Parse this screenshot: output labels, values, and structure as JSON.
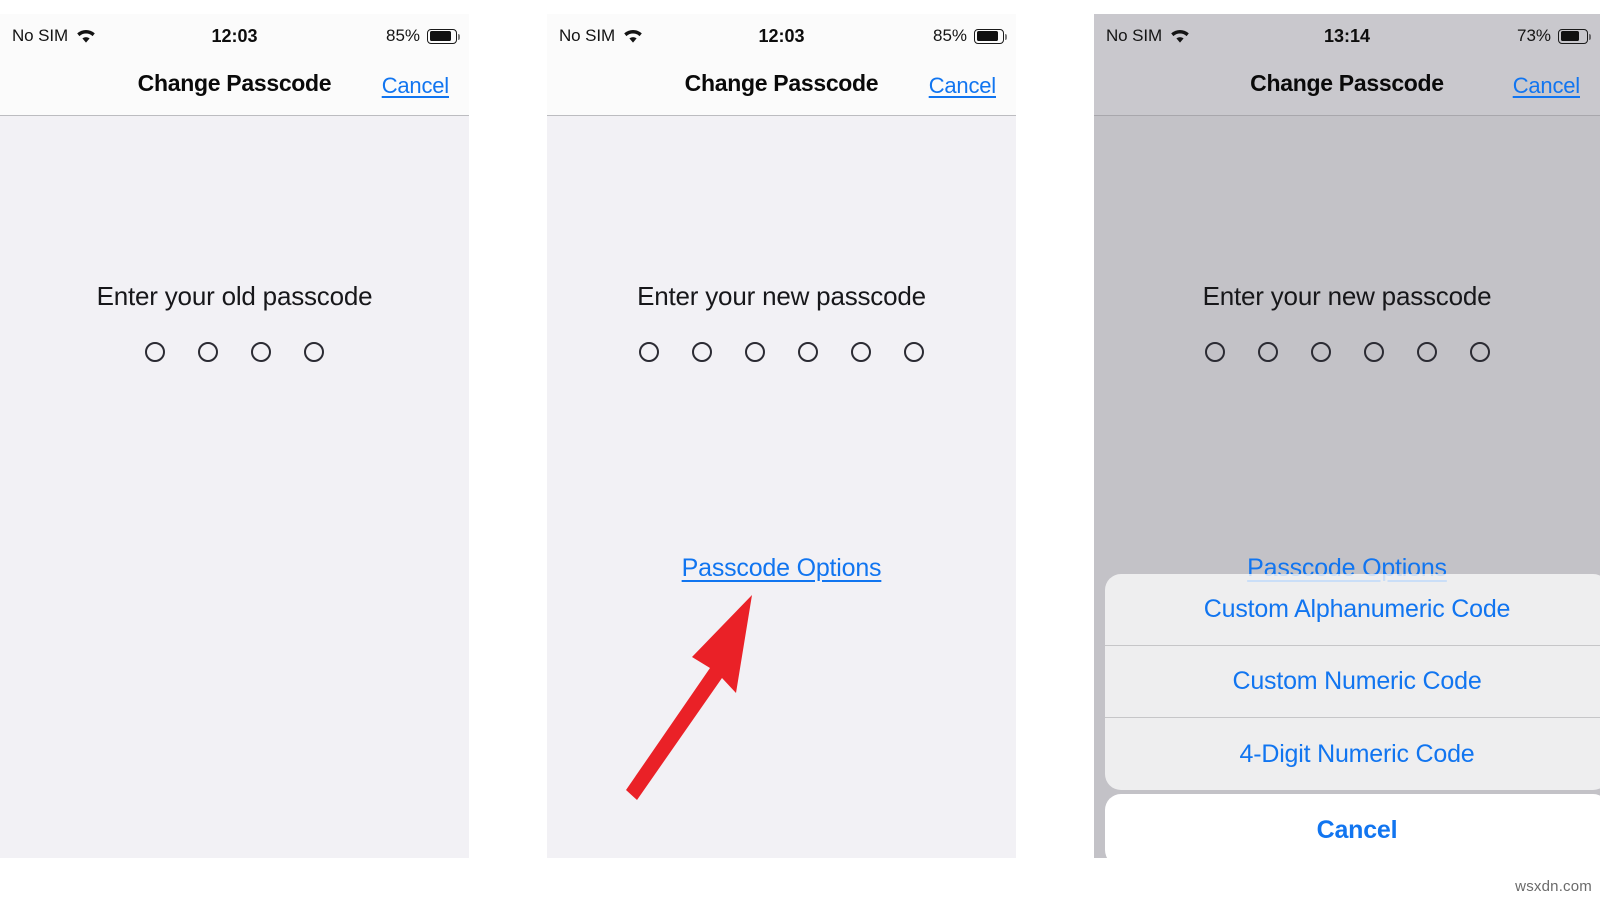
{
  "watermark": "wsxdn.com",
  "colors": {
    "accent_blue": "#1175f0",
    "arrow_red": "#ea2127",
    "screen_bg": "#f2f1f5",
    "dimmed_bg": "#c3c2c7",
    "bar_bg": "#fbfbfb",
    "text": "#141414"
  },
  "panels": [
    {
      "id": "panel-old-passcode",
      "status_bar": {
        "carrier": "No SIM",
        "wifi_icon": "wifi-icon",
        "time": "12:03",
        "battery_percent": "85%",
        "battery_icon": "battery-icon",
        "battery_level": 85
      },
      "nav": {
        "title": "Change Passcode",
        "cancel_label": "Cancel"
      },
      "prompt": "Enter your old passcode",
      "dot_count": 4,
      "passcode_options_label": null,
      "dimmed": false
    },
    {
      "id": "panel-new-passcode",
      "status_bar": {
        "carrier": "No SIM",
        "wifi_icon": "wifi-icon",
        "time": "12:03",
        "battery_percent": "85%",
        "battery_icon": "battery-icon",
        "battery_level": 85
      },
      "nav": {
        "title": "Change Passcode",
        "cancel_label": "Cancel"
      },
      "prompt": "Enter your new passcode",
      "dot_count": 6,
      "passcode_options_label": "Passcode Options",
      "dimmed": false
    },
    {
      "id": "panel-passcode-options-sheet",
      "status_bar": {
        "carrier": "No SIM",
        "wifi_icon": "wifi-icon",
        "time": "13:14",
        "battery_percent": "73%",
        "battery_icon": "battery-icon",
        "battery_level": 73
      },
      "nav": {
        "title": "Change Passcode",
        "cancel_label": "Cancel"
      },
      "prompt": "Enter your new passcode",
      "dot_count": 6,
      "passcode_options_label": "Passcode Options",
      "dimmed": true,
      "action_sheet": {
        "options": [
          "Custom Alphanumeric Code",
          "Custom Numeric Code",
          "4-Digit Numeric Code"
        ],
        "cancel_label": "Cancel"
      }
    }
  ],
  "annotation": {
    "arrow_icon": "red-arrow-icon",
    "points_at": "Passcode Options"
  }
}
